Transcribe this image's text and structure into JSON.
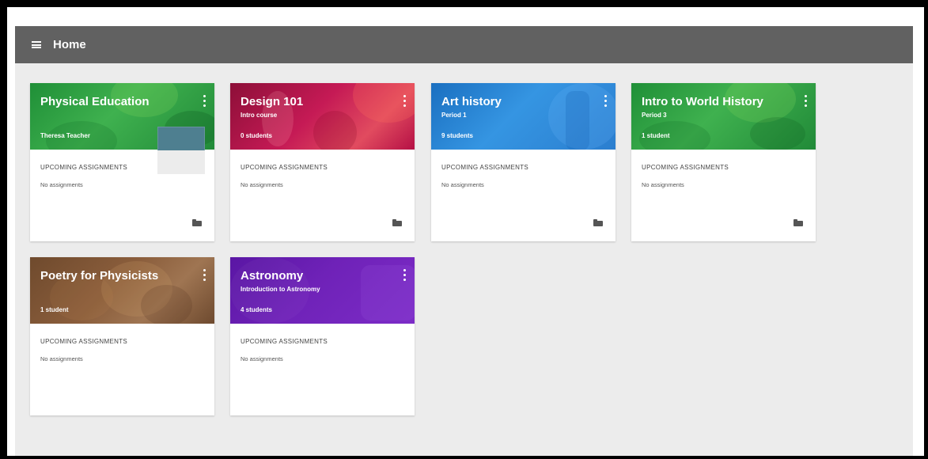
{
  "topbar": {
    "title": "Home",
    "menu_icon": "menu-icon"
  },
  "cards": [
    {
      "title": "Physical Education",
      "subtitle": "",
      "meta": "Theresa Teacher",
      "section_label": "UPCOMING ASSIGNMENTS",
      "section_value": "No assignments",
      "theme": "#2e9e44",
      "show_folder": true
    },
    {
      "title": "Design 101",
      "subtitle": "Intro course",
      "meta": "0 students",
      "section_label": "UPCOMING ASSIGNMENTS",
      "section_value": "No assignments",
      "theme": "#c4124e",
      "show_folder": true
    },
    {
      "title": "Art history",
      "subtitle": "Period 1",
      "meta": "9 students",
      "section_label": "UPCOMING ASSIGNMENTS",
      "section_value": "No assignments",
      "theme": "#2a8fdb",
      "show_folder": true
    },
    {
      "title": "Intro to World History",
      "subtitle": "Period 3",
      "meta": "1 student",
      "section_label": "UPCOMING ASSIGNMENTS",
      "section_value": "No assignments",
      "theme": "#2e9e44",
      "show_folder": true
    },
    {
      "title": "Poetry for Physicists",
      "subtitle": "",
      "meta": "1 student",
      "section_label": "UPCOMING ASSIGNMENTS",
      "section_value": "No assignments",
      "theme": "#8b5e3c",
      "show_folder": false
    },
    {
      "title": "Astronomy",
      "subtitle": "Introduction to Astronomy",
      "meta": "4 students",
      "section_label": "UPCOMING ASSIGNMENTS",
      "section_value": "No assignments",
      "theme": "#6a1fb0",
      "show_folder": false
    }
  ]
}
